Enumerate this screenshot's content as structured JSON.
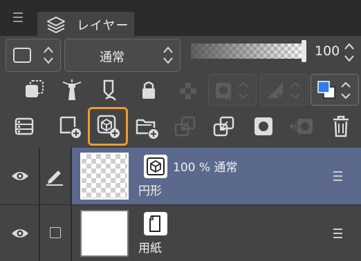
{
  "window": {
    "tab_label": "レイヤー"
  },
  "toolbar": {
    "blend_mode": "通常",
    "opacity": "100",
    "opacity_fraction": 1.0
  },
  "layers": [
    {
      "info": "100 % 通常",
      "name": "円形",
      "type_icon": "3d-object-icon",
      "selected": true,
      "thumbnail": "transparent"
    },
    {
      "info": "",
      "name": "用紙",
      "type_icon": "paper-icon",
      "selected": false,
      "thumbnail": "white"
    }
  ],
  "colors": {
    "accent_outline": "#f39a2d",
    "selected_row": "#5b6a8c",
    "layer_color_blue": "#2f7de9"
  }
}
